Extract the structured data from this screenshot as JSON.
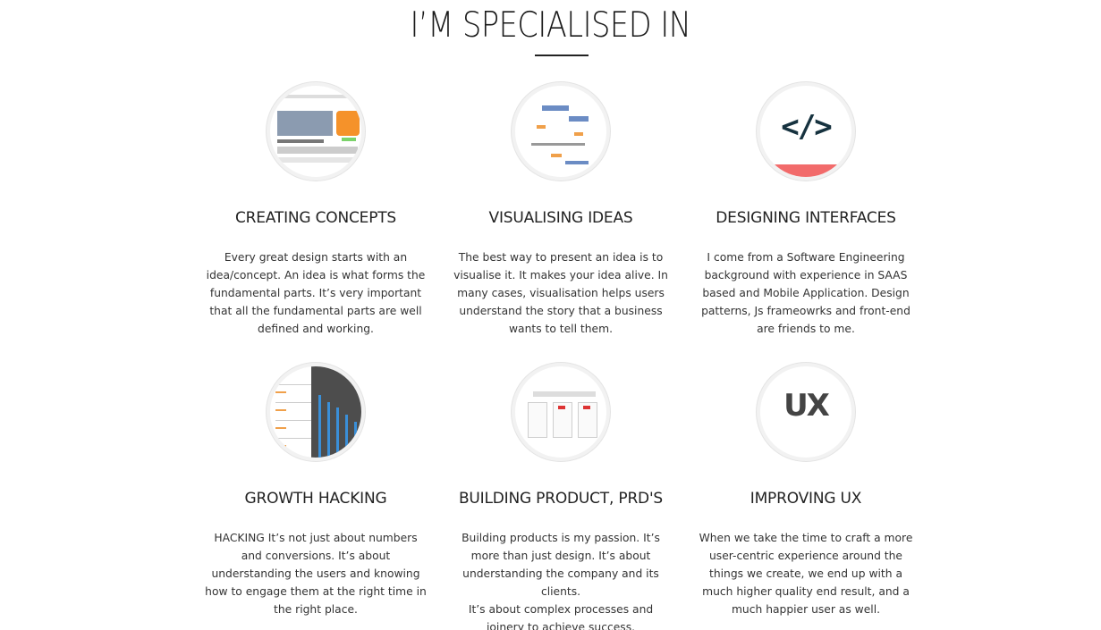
{
  "section": {
    "title": "I’M SPECIALISED IN"
  },
  "cards": [
    {
      "title": "CREATING CONCEPTS",
      "text": "Every great design starts with an idea/concept. An idea is what forms the fundamental parts. It’s very important that all the fundamental parts are well defined and working.",
      "icon": "concept-wireframe-icon"
    },
    {
      "title": "VISUALISING IDEAS",
      "text": "The best way to present an idea is to visualise it. It makes your idea alive. In many cases, visualisation helps users understand the story that a business wants to tell them.",
      "icon": "sitemap-diagram-icon"
    },
    {
      "title": "DESIGNING INTERFACES",
      "text": "I come from a Software Engineering background with experience in SAAS based and Mobile Application. Design patterns, Js frameowrks and front-end are friends to me.",
      "icon": "code-brackets-icon",
      "glyph": "</>"
    },
    {
      "title": "GROWTH HACKING",
      "text": "HACKING It’s not just about numbers and conversions. It’s about understanding the users and knowing how to engage them at the right time in the right place.",
      "icon": "growth-chart-icon"
    },
    {
      "title": "BUILDING PRODUCT, PRD's",
      "text_lines": [
        "Building products is my passion. It’s more than just design. It’s about understanding the company and its clients.",
        "It’s about complex processes and joinery to achieve success."
      ],
      "icon": "product-document-icon"
    },
    {
      "title": "IMPROVING UX",
      "text": "When we take the time to craft a more user-centric experience around the things we create, we end up with a much higher quality end result, and a much happier user as well.",
      "icon": "ux-badge-icon",
      "glyph": "UX"
    }
  ],
  "colors": {
    "accent_code_bg": "#73c5cf",
    "accent_code_bar": "#f26b6b",
    "ux_blue": "#1e8fc9",
    "concept_orange": "#f5922a"
  }
}
